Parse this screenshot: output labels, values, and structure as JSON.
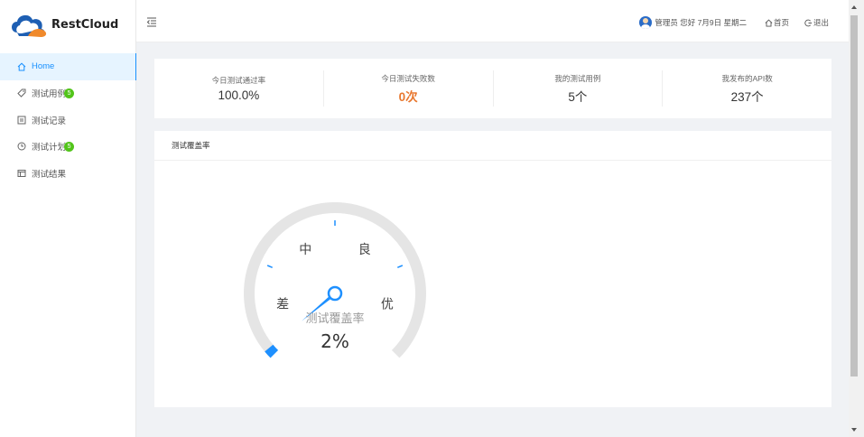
{
  "brand": {
    "name": "RestCloud"
  },
  "sidebar": {
    "items": [
      {
        "label": "Home",
        "icon": "home-icon",
        "active": true
      },
      {
        "label": "测试用例",
        "icon": "tag-icon",
        "badge": "5"
      },
      {
        "label": "测试记录",
        "icon": "record-icon"
      },
      {
        "label": "测试计划",
        "icon": "clock-icon",
        "badge": "5"
      },
      {
        "label": "测试结果",
        "icon": "result-icon"
      }
    ]
  },
  "header": {
    "greeting": "管理员 您好 7月9日 星期二",
    "home_label": "首页",
    "logout_label": "退出"
  },
  "stats": [
    {
      "label": "今日测试通过率",
      "value": "100.0%"
    },
    {
      "label": "今日测试失败数",
      "value": "0次"
    },
    {
      "label": "我的测试用例",
      "value": "5个"
    },
    {
      "label": "我发布的API数",
      "value": "237个"
    }
  ],
  "panel": {
    "title": "测试覆盖率"
  },
  "gauge": {
    "name": "测试覆盖率",
    "value_text": "2%",
    "value": 2,
    "min": 0,
    "max": 100,
    "labels": [
      "差",
      "中",
      "良",
      "优"
    ],
    "colors": {
      "track": "#e5e5e5",
      "progress": "#1e90ff",
      "ticks": "#1e90ff"
    }
  },
  "colors": {
    "accent": "#1890ff",
    "badge": "#52c41a",
    "warn": "#e8772e"
  }
}
